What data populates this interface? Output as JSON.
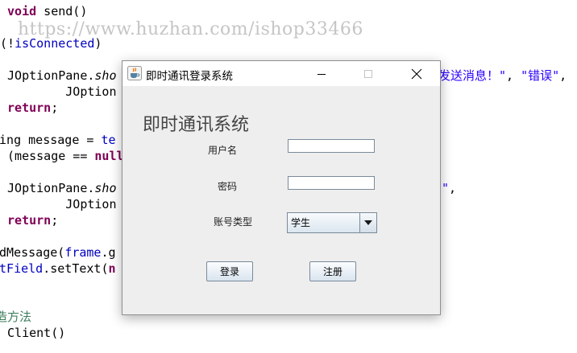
{
  "code_editor": {
    "lines": [
      {
        "parts": [
          {
            "t": " ",
            "c": ""
          },
          {
            "t": "void",
            "c": "kw"
          },
          {
            "t": " send()",
            "c": ""
          }
        ]
      },
      {
        "parts": [
          {
            "t": "(",
            "c": ""
          },
          {
            "t": "!",
            "c": ""
          },
          {
            "t": "isConnected",
            "c": "fld"
          },
          {
            "t": ")",
            "c": ""
          }
        ]
      },
      {
        "parts": [
          {
            "t": " JOptionPane.",
            "c": ""
          },
          {
            "t": "sho",
            "c": "itl"
          }
        ]
      },
      {
        "parts": [
          {
            "t": "         JOption",
            "c": ""
          }
        ]
      },
      {
        "parts": [
          {
            "t": " ",
            "c": ""
          },
          {
            "t": "return",
            "c": "kw"
          },
          {
            "t": ";",
            "c": ""
          }
        ]
      },
      {
        "parts": [
          {
            "t": "ring message = ",
            "c": ""
          },
          {
            "t": "te",
            "c": "fld"
          }
        ]
      },
      {
        "parts": [
          {
            "t": " (message == ",
            "c": ""
          },
          {
            "t": "null",
            "c": "kw"
          }
        ]
      },
      {
        "parts": [
          {
            "t": " JOptionPane.",
            "c": ""
          },
          {
            "t": "sho",
            "c": "itl"
          }
        ]
      },
      {
        "parts": [
          {
            "t": "         JOption",
            "c": ""
          }
        ]
      },
      {
        "parts": [
          {
            "t": " ",
            "c": ""
          },
          {
            "t": "return",
            "c": "kw"
          },
          {
            "t": ";",
            "c": ""
          }
        ]
      },
      {
        "parts": [
          {
            "t": "ndMessage(",
            "c": ""
          },
          {
            "t": "frame",
            "c": "fld"
          },
          {
            "t": ".g",
            "c": ""
          }
        ]
      },
      {
        "parts": [
          {
            "t": "xtField",
            "c": "fld"
          },
          {
            "t": ".setText(",
            "c": ""
          },
          {
            "t": "n",
            "c": "kw"
          }
        ]
      },
      {
        "parts": [
          {
            "t": "造方法",
            "c": "cmt"
          }
        ]
      },
      {
        "parts": [
          {
            "t": " Client()",
            "c": ""
          }
        ]
      }
    ],
    "right_line_1": [
      {
        "t": "发送消息！\"",
        "c": "str"
      },
      {
        "t": ", ",
        "c": ""
      },
      {
        "t": "\"错误\"",
        "c": "str"
      },
      {
        "t": ",",
        "c": ""
      }
    ],
    "right_line_2": [
      {
        "t": "\"",
        "c": "str"
      },
      {
        "t": ",",
        "c": ""
      }
    ]
  },
  "watermark": "https://www.huzhan.com/ishop33466",
  "window": {
    "title": "即时通讯登录系统",
    "heading": "即时通讯系统",
    "username_label": "用户名",
    "username_value": "",
    "password_label": "密码",
    "password_value": "",
    "account_type_label": "账号类型",
    "account_type_value": "学生",
    "login_button": "登录",
    "register_button": "注册"
  },
  "icons": {
    "app": "java-cup-icon",
    "minimize": "minimize-icon",
    "maximize": "maximize-icon",
    "close": "close-icon",
    "dropdown": "chevron-down-icon"
  },
  "colors": {
    "keyword": "#7f0055",
    "field": "#0000c0",
    "string": "#2a00ff",
    "comment": "#3f7f5f"
  }
}
